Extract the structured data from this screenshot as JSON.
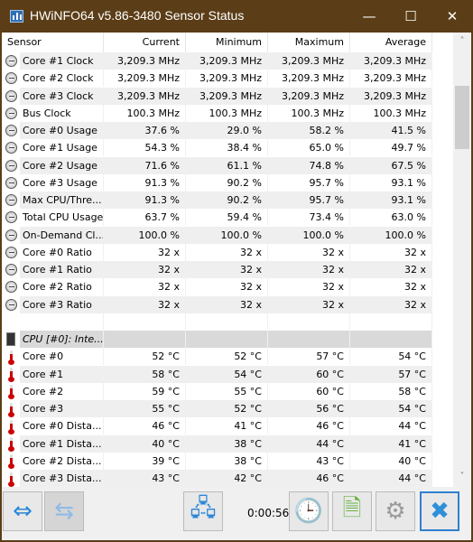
{
  "window": {
    "title": "HWiNFO64 v5.86-3480 Sensor Status",
    "minimize": "—",
    "maximize": "☐",
    "close": "✕"
  },
  "columns": [
    "Sensor",
    "Current",
    "Minimum",
    "Maximum",
    "Average"
  ],
  "rows": [
    {
      "icon": "clock-icon",
      "name": "Core #1 Clock",
      "values": [
        "3,209.3 MHz",
        "3,209.3 MHz",
        "3,209.3 MHz",
        "3,209.3 MHz"
      ]
    },
    {
      "icon": "clock-icon",
      "name": "Core #2 Clock",
      "values": [
        "3,209.3 MHz",
        "3,209.3 MHz",
        "3,209.3 MHz",
        "3,209.3 MHz"
      ]
    },
    {
      "icon": "clock-icon",
      "name": "Core #3 Clock",
      "values": [
        "3,209.3 MHz",
        "3,209.3 MHz",
        "3,209.3 MHz",
        "3,209.3 MHz"
      ]
    },
    {
      "icon": "clock-icon",
      "name": "Bus Clock",
      "values": [
        "100.3 MHz",
        "100.3 MHz",
        "100.3 MHz",
        "100.3 MHz"
      ]
    },
    {
      "icon": "clock-icon",
      "name": "Core #0 Usage",
      "values": [
        "37.6 %",
        "29.0 %",
        "58.2 %",
        "41.5 %"
      ]
    },
    {
      "icon": "clock-icon",
      "name": "Core #1 Usage",
      "values": [
        "54.3 %",
        "38.4 %",
        "65.0 %",
        "49.7 %"
      ]
    },
    {
      "icon": "clock-icon",
      "name": "Core #2 Usage",
      "values": [
        "71.6 %",
        "61.1 %",
        "74.8 %",
        "67.5 %"
      ]
    },
    {
      "icon": "clock-icon",
      "name": "Core #3 Usage",
      "values": [
        "91.3 %",
        "90.2 %",
        "95.7 %",
        "93.1 %"
      ]
    },
    {
      "icon": "clock-icon",
      "name": "Max CPU/Thre...",
      "values": [
        "91.3 %",
        "90.2 %",
        "95.7 %",
        "93.1 %"
      ]
    },
    {
      "icon": "clock-icon",
      "name": "Total CPU Usage",
      "values": [
        "63.7 %",
        "59.4 %",
        "73.4 %",
        "63.0 %"
      ]
    },
    {
      "icon": "clock-icon",
      "name": "On-Demand Cl...",
      "values": [
        "100.0 %",
        "100.0 %",
        "100.0 %",
        "100.0 %"
      ]
    },
    {
      "icon": "clock-icon",
      "name": "Core #0 Ratio",
      "values": [
        "32 x",
        "32 x",
        "32 x",
        "32 x"
      ]
    },
    {
      "icon": "clock-icon",
      "name": "Core #1 Ratio",
      "values": [
        "32 x",
        "32 x",
        "32 x",
        "32 x"
      ]
    },
    {
      "icon": "clock-icon",
      "name": "Core #2 Ratio",
      "values": [
        "32 x",
        "32 x",
        "32 x",
        "32 x"
      ]
    },
    {
      "icon": "clock-icon",
      "name": "Core #3 Ratio",
      "values": [
        "32 x",
        "32 x",
        "32 x",
        "32 x"
      ]
    },
    {
      "icon": "",
      "name": "",
      "values": [
        "",
        "",
        "",
        ""
      ]
    },
    {
      "icon": "chip-icon",
      "name": "CPU [#0]: Inte...",
      "values": [
        "",
        "",
        "",
        ""
      ],
      "group": true
    },
    {
      "icon": "thermometer-icon",
      "name": "Core #0",
      "values": [
        "52 °C",
        "52 °C",
        "57 °C",
        "54 °C"
      ]
    },
    {
      "icon": "thermometer-icon",
      "name": "Core #1",
      "values": [
        "58 °C",
        "54 °C",
        "60 °C",
        "57 °C"
      ]
    },
    {
      "icon": "thermometer-icon",
      "name": "Core #2",
      "values": [
        "59 °C",
        "55 °C",
        "60 °C",
        "58 °C"
      ]
    },
    {
      "icon": "thermometer-icon",
      "name": "Core #3",
      "values": [
        "55 °C",
        "52 °C",
        "56 °C",
        "54 °C"
      ]
    },
    {
      "icon": "thermometer-icon",
      "name": "Core #0 Dista...",
      "values": [
        "46 °C",
        "41 °C",
        "46 °C",
        "44 °C"
      ]
    },
    {
      "icon": "thermometer-icon",
      "name": "Core #1 Dista...",
      "values": [
        "40 °C",
        "38 °C",
        "44 °C",
        "41 °C"
      ]
    },
    {
      "icon": "thermometer-icon",
      "name": "Core #2 Dista...",
      "values": [
        "39 °C",
        "38 °C",
        "43 °C",
        "40 °C"
      ]
    },
    {
      "icon": "thermometer-icon",
      "name": "Core #3 Dista...",
      "values": [
        "43 °C",
        "42 °C",
        "46 °C",
        "44 °C"
      ]
    }
  ],
  "scrollbar": {
    "up": "˄",
    "down": "˅"
  },
  "toolbar": {
    "timer": "0:00:56"
  }
}
